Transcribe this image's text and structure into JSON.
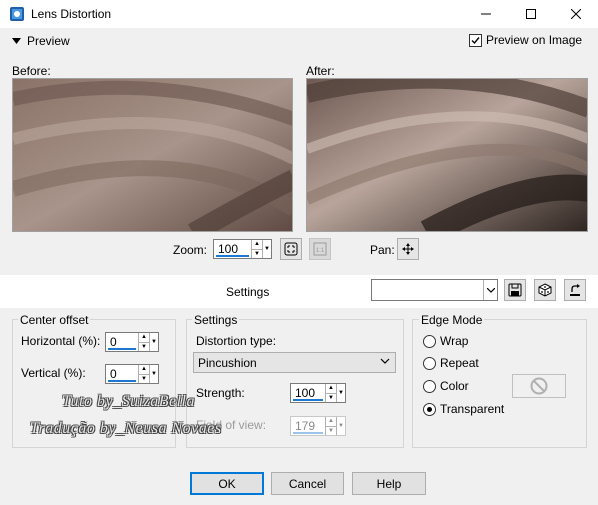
{
  "window": {
    "title": "Lens Distortion"
  },
  "preview": {
    "label": "Preview",
    "on_image_label": "Preview on Image",
    "on_image_checked": true
  },
  "panes": {
    "before_label": "Before:",
    "after_label": "After:"
  },
  "zoom": {
    "label": "Zoom:",
    "value": "100"
  },
  "pan": {
    "label": "Pan:"
  },
  "settings_strip": {
    "label": "Settings",
    "preset_value": ""
  },
  "center_offset": {
    "title": "Center offset",
    "horizontal_label": "Horizontal (%):",
    "horizontal_value": "0",
    "vertical_label": "Vertical (%):",
    "vertical_value": "0"
  },
  "settings": {
    "title": "Settings",
    "distortion_type_label": "Distortion type:",
    "distortion_type_value": "Pincushion",
    "strength_label": "Strength:",
    "strength_value": "100",
    "field_of_view_label": "Field of view:",
    "field_of_view_value": "179"
  },
  "edge_mode": {
    "title": "Edge Mode",
    "options": [
      "Wrap",
      "Repeat",
      "Color",
      "Transparent"
    ],
    "selected": "Transparent"
  },
  "watermark": {
    "line1": "Tuto by_SuizaBella",
    "line2": "Tradução by_Neusa Novaes"
  },
  "buttons": {
    "ok": "OK",
    "cancel": "Cancel",
    "help": "Help"
  },
  "colors": {
    "accent": "#0078d7",
    "preview_dark": "#5a4a44",
    "preview_light": "#b8a49a"
  }
}
